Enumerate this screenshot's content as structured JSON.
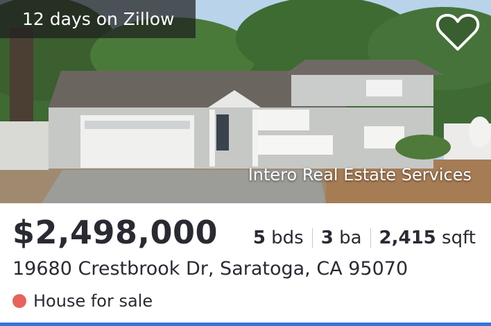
{
  "badge": {
    "days_label": "12 days on Zillow"
  },
  "photo": {
    "credit": "Intero Real Estate Services",
    "favorite_icon": "heart-outline-icon"
  },
  "listing": {
    "price": "$2,498,000",
    "beds_num": "5",
    "beds_unit": "bds",
    "baths_num": "3",
    "baths_unit": "ba",
    "sqft_num": "2,415",
    "sqft_unit": "sqft",
    "address": "19680 Crestbrook Dr, Saratoga, CA 95070",
    "status": "House for sale"
  },
  "colors": {
    "status_dot": "#e8635a",
    "accent_bar": "#3a73d6",
    "text": "#2a2a33"
  }
}
